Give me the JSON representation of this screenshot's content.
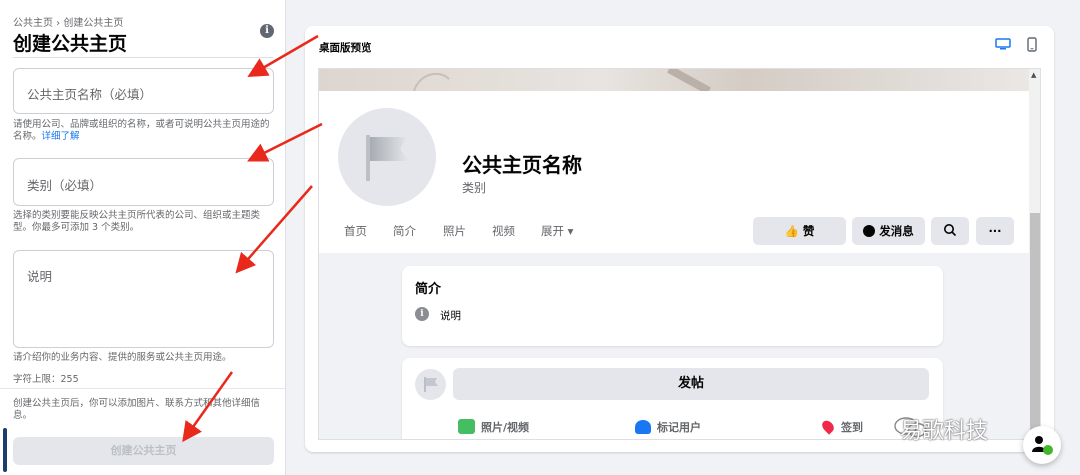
{
  "left_panel": {
    "breadcrumb": "公共主页 › 创建公共主页",
    "title": "创建公共主页",
    "info_icon": "i",
    "name_field": {
      "placeholder": "公共主页名称（必填）"
    },
    "name_help": "请使用公司、品牌或组织的名称，或者可说明公共主页用途的名称。",
    "name_help_link": "详细了解",
    "category_field": {
      "placeholder": "类别（必填）"
    },
    "category_help": "选择的类别要能反映公共主页所代表的公司、组织或主题类型。你最多可添加 3 个类别。",
    "description_field": {
      "placeholder": "说明"
    },
    "description_help": "请介绍你的业务内容、提供的服务或公共主页用途。",
    "char_limit": "字符上限：255",
    "bottom_note": "创建公共主页后，你可以添加图片、联系方式和其他详细信息。",
    "create_button": "创建公共主页"
  },
  "preview": {
    "label": "桌面版预览",
    "view_icons": [
      "desktop-icon",
      "mobile-icon"
    ],
    "page_name": "公共主页名称",
    "category": "类别",
    "nav_items": [
      "首页",
      "简介",
      "照片",
      "视频",
      "展开 ▾"
    ],
    "like_button": "赞",
    "message_button": "发消息",
    "more_button": "···",
    "about_title": "简介",
    "about_info_icon": "i",
    "about_text": "说明",
    "post_button": "发帖",
    "actions": [
      "照片/视频",
      "标记用户",
      "签到"
    ]
  },
  "watermark": "易歌科技",
  "colors": {
    "accent": "#1877f2",
    "arrow": "#e8291c",
    "disabled_button_bg": "#e4e6eb"
  }
}
